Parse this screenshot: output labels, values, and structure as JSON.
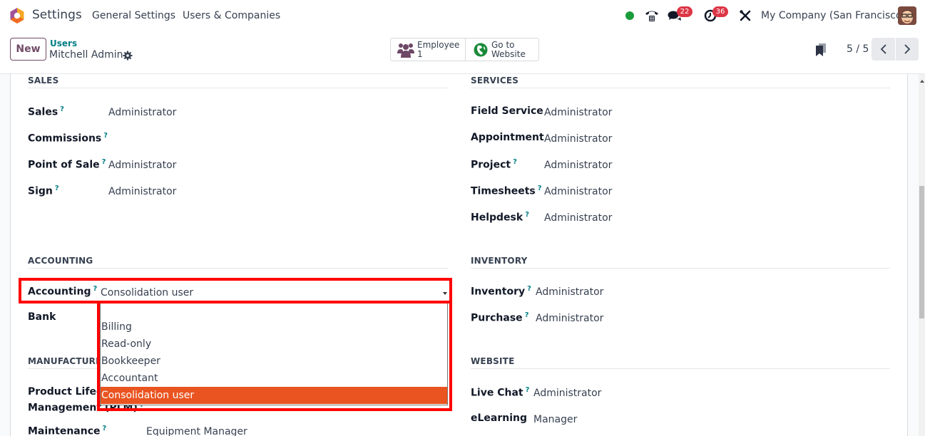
{
  "navbar": {
    "app_title": "Settings",
    "menus": [
      "General Settings",
      "Users & Companies"
    ],
    "chat_badge": "22",
    "activity_badge": "36",
    "company": "My Company (San Francisco)",
    "presence_color": "#1a9c3b"
  },
  "control": {
    "new_label": "New",
    "breadcrumb_parent": "Users",
    "breadcrumb_current": "Mitchell Admin",
    "smart_buttons": [
      {
        "line1": "Employee",
        "line2": "1",
        "icon": "users-icon"
      },
      {
        "line1": "Go to",
        "line2": "Website",
        "icon": "globe-icon"
      }
    ],
    "pager": "5 / 5"
  },
  "sections": {
    "sales": {
      "title": "SALES",
      "fields": [
        {
          "label": "Sales",
          "help": "?",
          "value": "Administrator"
        },
        {
          "label": "Commissions",
          "help": "?",
          "value": ""
        },
        {
          "label": "Point of Sale",
          "help": "?",
          "value": "Administrator"
        },
        {
          "label": "Sign",
          "help": "?",
          "value": "Administrator"
        }
      ]
    },
    "services": {
      "title": "SERVICES",
      "fields": [
        {
          "label": "Field Service",
          "help": "",
          "value": "Administrator"
        },
        {
          "label": "Appointment",
          "help": "",
          "value": "Administrator"
        },
        {
          "label": "Project",
          "help": "?",
          "value": "Administrator"
        },
        {
          "label": "Timesheets",
          "help": "?",
          "value": "Administrator"
        },
        {
          "label": "Helpdesk",
          "help": "?",
          "value": "Administrator"
        }
      ]
    },
    "accounting": {
      "title": "ACCOUNTING",
      "fields": [
        {
          "label": "Accounting",
          "help": "?",
          "value": "Consolidation user"
        },
        {
          "label": "Bank",
          "help": "",
          "value": ""
        }
      ],
      "dropdown_options": [
        "",
        "Billing",
        "Read-only",
        "Bookkeeper",
        "Accountant",
        "Consolidation user"
      ],
      "selected_option": "Consolidation user",
      "selected_color": "#e95420"
    },
    "manufacturing": {
      "title": "MANUFACTURING",
      "fields": [
        {
          "label": "Product Lifecycle",
          "label2": "Management (PLM)",
          "help": "?",
          "value": ""
        },
        {
          "label": "Maintenance",
          "help": "?",
          "value": "Equipment Manager"
        }
      ]
    },
    "inventory": {
      "title": "INVENTORY",
      "fields": [
        {
          "label": "Inventory",
          "help": "?",
          "value": "Administrator"
        },
        {
          "label": "Purchase",
          "help": "?",
          "value": "Administrator"
        }
      ]
    },
    "website": {
      "title": "WEBSITE",
      "fields": [
        {
          "label": "Live Chat",
          "help": "?",
          "value": "Administrator"
        },
        {
          "label": "eLearning",
          "help": "",
          "value": "Manager"
        }
      ]
    }
  },
  "annotation_color": "#ff0000"
}
